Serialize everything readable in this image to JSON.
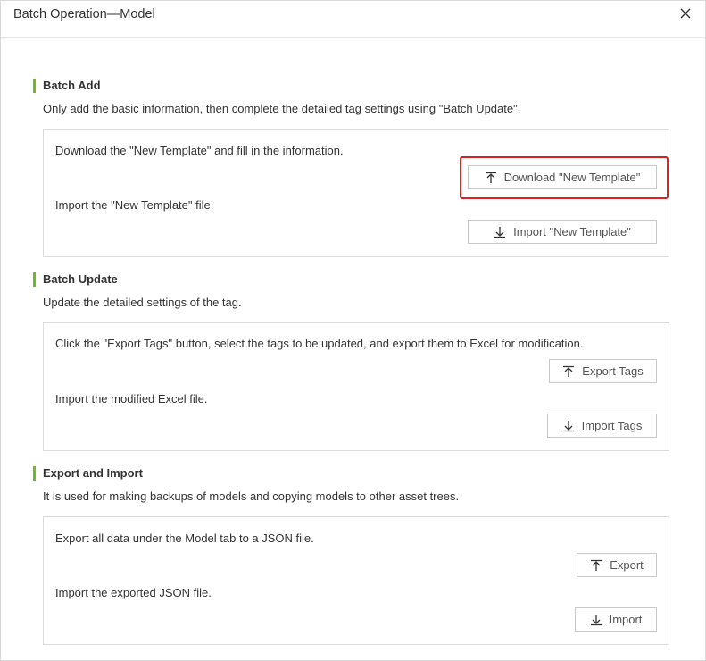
{
  "dialog": {
    "title": "Batch Operation—Model"
  },
  "sections": {
    "batch_add": {
      "title": "Batch Add",
      "desc": "Only add the basic information, then complete the detailed tag settings using \"Batch Update\".",
      "row1_text": "Download the \"New Template\" and fill in the information.",
      "row1_button": "Download \"New Template\"",
      "row2_text": "Import the \"New Template\" file.",
      "row2_button": "Import \"New Template\""
    },
    "batch_update": {
      "title": "Batch Update",
      "desc": "Update the detailed settings of the tag.",
      "row1_text": "Click the \"Export Tags\" button, select the tags to be updated, and export them to Excel for modification.",
      "row1_button": "Export Tags",
      "row2_text": "Import the modified Excel file.",
      "row2_button": "Import Tags"
    },
    "export_import": {
      "title": "Export and Import",
      "desc": "It is used for making backups of models and copying models to other asset trees.",
      "row1_text": "Export all data under the Model tab to a JSON file.",
      "row1_button": "Export",
      "row2_text": "Import the exported JSON file.",
      "row2_button": "Import"
    }
  },
  "colors": {
    "accent": "#6cbf1b",
    "highlight": "#e02020"
  },
  "icons": {
    "export": "upload-arrow-icon",
    "import": "download-arrow-icon",
    "close": "close-icon"
  }
}
